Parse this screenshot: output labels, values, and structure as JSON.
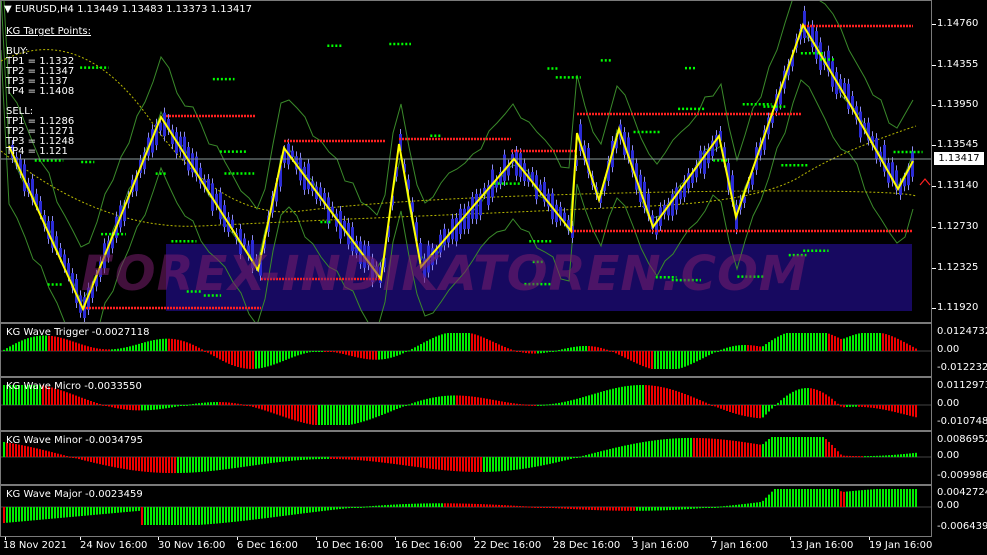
{
  "main_chart": {
    "symbol_title": "EURUSD,H4  1.13449 1.13483 1.13373 1.13417",
    "current_price": "1.13417",
    "y_ticks": [
      "1.14760",
      "1.14355",
      "1.13950",
      "1.13545",
      "1.13140",
      "1.12730",
      "1.12325",
      "1.11920"
    ],
    "watermark": "FOREX-INDIKATOREN.COM",
    "kg_panel": {
      "title": "KG Target Points:",
      "buy_label": "BUY:",
      "buy_tp": [
        "TP1 = 1.1332",
        "TP2 = 1.1347",
        "TP3 = 1.137",
        "TP4 = 1.1408"
      ],
      "sell_label": "SELL:",
      "sell_tp": [
        "TP1 = 1.1286",
        "TP2 = 1.1271",
        "TP3 = 1.1248",
        "TP4 = 1.121"
      ]
    }
  },
  "indicators": [
    {
      "title": "KG Wave Trigger  -0.0027118",
      "ticks": [
        "0.0124732",
        "0.00",
        "-0.0122321"
      ],
      "amp": 18
    },
    {
      "title": "KG Wave Micro  -0.0033550",
      "ticks": [
        "0.0112973",
        "0.00",
        "-0.0107481"
      ],
      "amp": 20
    },
    {
      "title": "KG Wave Minor  -0.0034795",
      "ticks": [
        "0.0086952",
        "0.00",
        "-0.009986"
      ],
      "amp": 20
    },
    {
      "title": "KG Wave Major  -0.0023459",
      "ticks": [
        "0.0042724",
        "0.00",
        "-0.006439"
      ],
      "amp": 18
    }
  ],
  "x_ticks": [
    "18 Nov 2021",
    "24 Nov 16:00",
    "30 Nov 16:00",
    "6 Dec 16:00",
    "10 Dec 16:00",
    "16 Dec 16:00",
    "22 Dec 16:00",
    "28 Dec 16:00",
    "3 Jan 16:00",
    "7 Jan 16:00",
    "13 Jan 16:00",
    "19 Jan 16:00"
  ],
  "colors": {
    "candle": "#2b2bd6",
    "zigzag": "#ffff00",
    "resistance": "#ff2020",
    "support_dots": "#00ff00",
    "envelope": "#3a8a2a",
    "bull_hist": "#00ee00",
    "bear_hist": "#ee0000",
    "background": "#000000"
  }
}
